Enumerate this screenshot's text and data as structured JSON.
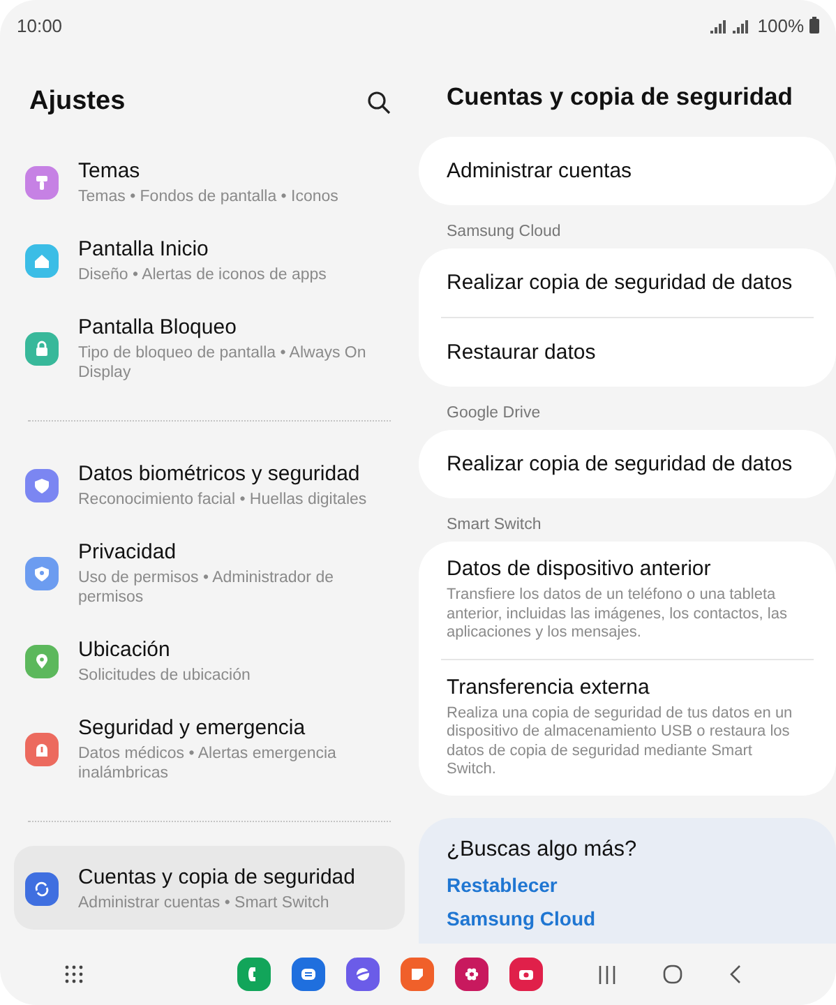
{
  "status_bar": {
    "time": "10:00",
    "battery": "100%"
  },
  "settings": {
    "title": "Ajustes",
    "groups": [
      {
        "items": [
          {
            "color": "#c681e4",
            "title": "Temas",
            "subtitle": "Temas • Fondos de pantalla • Iconos",
            "selected": false
          },
          {
            "color": "#3bbde6",
            "title": "Pantalla Inicio",
            "subtitle": "Diseño • Alertas de iconos de apps",
            "selected": false
          },
          {
            "color": "#38b89a",
            "title": "Pantalla Bloqueo",
            "subtitle": "Tipo de bloqueo de pantalla • Always On Display",
            "selected": false
          }
        ]
      },
      {
        "items": [
          {
            "color": "#7b86f2",
            "title": "Datos biométricos y seguridad",
            "subtitle": "Reconocimiento facial • Huellas digitales",
            "selected": false
          },
          {
            "color": "#6c9cf0",
            "title": "Privacidad",
            "subtitle": "Uso de permisos • Administrador de permisos",
            "selected": false
          },
          {
            "color": "#5cb85c",
            "title": "Ubicación",
            "subtitle": "Solicitudes de ubicación",
            "selected": false
          },
          {
            "color": "#ec6a5e",
            "title": "Seguridad y emergencia",
            "subtitle": "Datos médicos • Alertas emergencia inalámbricas",
            "selected": false
          }
        ]
      },
      {
        "items": [
          {
            "color": "#3f6fe0",
            "title": "Cuentas y copia de seguridad",
            "subtitle": "Administrar cuentas • Smart Switch",
            "selected": true
          }
        ]
      }
    ]
  },
  "detail": {
    "title": "Cuentas y copia de seguridad",
    "sections": [
      {
        "entries": [
          {
            "title": "Administrar cuentas"
          }
        ]
      },
      {
        "header": "Samsung Cloud",
        "entries": [
          {
            "title": "Realizar copia de seguridad de datos"
          },
          {
            "title": "Restaurar datos"
          }
        ]
      },
      {
        "header": "Google Drive",
        "entries": [
          {
            "title": "Realizar copia de seguridad de datos"
          }
        ]
      },
      {
        "header": "Smart Switch",
        "entries": [
          {
            "title": "Datos de dispositivo anterior",
            "description": "Transfiere los datos de un teléfono o una tableta anterior, incluidas las imágenes, los contactos, las aplicaciones y los mensajes."
          },
          {
            "title": "Transferencia externa",
            "description": "Realiza una copia de seguridad de tus datos en un dispositivo de almacenamiento USB o restaura los datos de copia de seguridad mediante Smart Switch."
          }
        ]
      }
    ],
    "suggestions": {
      "title": "¿Buscas algo más?",
      "links": [
        "Restablecer",
        "Samsung Cloud"
      ]
    }
  },
  "dock": {
    "apps": [
      {
        "color": "#12a55a"
      },
      {
        "color": "#1f6fde"
      },
      {
        "color": "#6b5ce8"
      },
      {
        "color": "#f0602a"
      },
      {
        "color": "#c8195e"
      },
      {
        "color": "#e0204a"
      }
    ]
  }
}
